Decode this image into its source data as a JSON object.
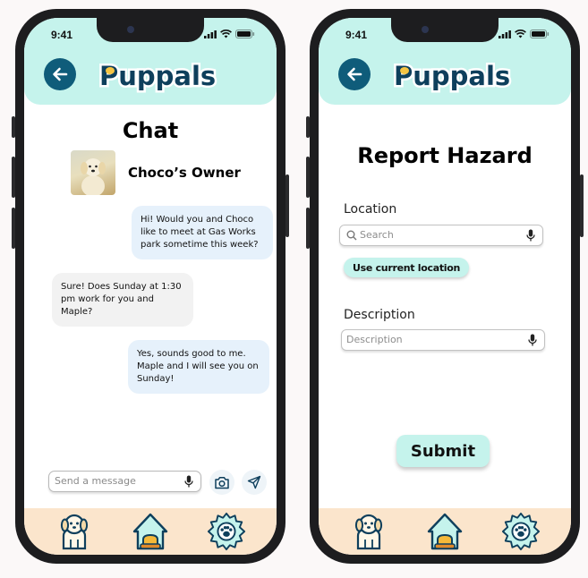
{
  "status_bar": {
    "time": "9:41"
  },
  "app": {
    "logo_text": "Puppals"
  },
  "chat_screen": {
    "title": "Chat",
    "contact_name": "Choco’s Owner",
    "messages": [
      {
        "direction": "out",
        "text": "Hi! Would you and Choco like to meet at Gas Works park sometime this week?"
      },
      {
        "direction": "in",
        "text": "Sure! Does Sunday at 1:30 pm work for you and Maple?"
      },
      {
        "direction": "out",
        "text": "Yes, sounds good to me. Maple and I will see you on Sunday!"
      }
    ],
    "message_input": {
      "placeholder": "Send a message",
      "value": ""
    }
  },
  "report_screen": {
    "title": "Report Hazard",
    "location_label": "Location",
    "search_input": {
      "placeholder": "Search",
      "value": ""
    },
    "use_location_label": "Use current location",
    "description_label": "Description",
    "description_input": {
      "placeholder": "Description",
      "value": ""
    },
    "submit_label": "Submit"
  },
  "bottom_nav": {
    "items": [
      {
        "icon": "dog-profile-icon"
      },
      {
        "icon": "home-icon"
      },
      {
        "icon": "settings-icon"
      }
    ]
  },
  "colors": {
    "header_bg": "#c5f3ec",
    "nav_bg": "#fbe5cc",
    "brand_dark": "#0e3f5c",
    "back_button": "#0f5c7a",
    "bubble_out": "#e6f1fb",
    "bubble_in": "#f2f2f2"
  }
}
